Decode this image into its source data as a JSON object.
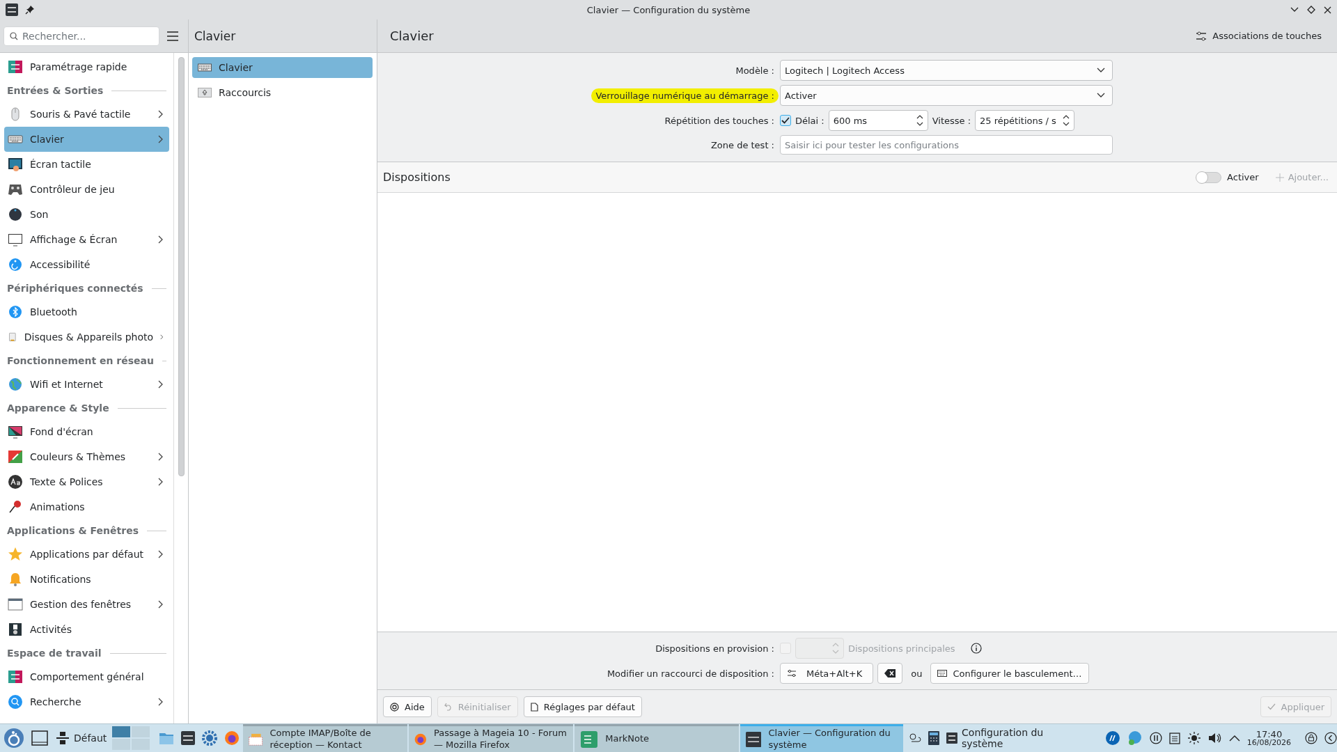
{
  "window": {
    "title": "Clavier — Configuration du système"
  },
  "sidebar": {
    "search": {
      "placeholder": "Rechercher..."
    },
    "entries": [
      {
        "kind": "item",
        "label": "Paramétrage rapide",
        "selected": false,
        "submenu": false
      },
      {
        "kind": "header",
        "label": "Entrées & Sorties"
      },
      {
        "kind": "item",
        "label": "Souris & Pavé tactile",
        "selected": false,
        "submenu": true
      },
      {
        "kind": "item",
        "label": "Clavier",
        "selected": true,
        "submenu": true
      },
      {
        "kind": "item",
        "label": "Écran tactile",
        "selected": false,
        "submenu": false
      },
      {
        "kind": "item",
        "label": "Contrôleur de jeu",
        "selected": false,
        "submenu": false
      },
      {
        "kind": "item",
        "label": "Son",
        "selected": false,
        "submenu": false
      },
      {
        "kind": "item",
        "label": "Affichage & Écran",
        "selected": false,
        "submenu": true
      },
      {
        "kind": "item",
        "label": "Accessibilité",
        "selected": false,
        "submenu": false
      },
      {
        "kind": "header",
        "label": "Périphériques connectés"
      },
      {
        "kind": "item",
        "label": "Bluetooth",
        "selected": false,
        "submenu": false
      },
      {
        "kind": "item",
        "label": "Disques & Appareils photo",
        "selected": false,
        "submenu": true
      },
      {
        "kind": "header",
        "label": "Fonctionnement en réseau"
      },
      {
        "kind": "item",
        "label": "Wifi et Internet",
        "selected": false,
        "submenu": true
      },
      {
        "kind": "header",
        "label": "Apparence & Style"
      },
      {
        "kind": "item",
        "label": "Fond d'écran",
        "selected": false,
        "submenu": false
      },
      {
        "kind": "item",
        "label": "Couleurs & Thèmes",
        "selected": false,
        "submenu": true
      },
      {
        "kind": "item",
        "label": "Texte & Polices",
        "selected": false,
        "submenu": true
      },
      {
        "kind": "item",
        "label": "Animations",
        "selected": false,
        "submenu": false
      },
      {
        "kind": "header",
        "label": "Applications & Fenêtres"
      },
      {
        "kind": "item",
        "label": "Applications par défaut",
        "selected": false,
        "submenu": true
      },
      {
        "kind": "item",
        "label": "Notifications",
        "selected": false,
        "submenu": false
      },
      {
        "kind": "item",
        "label": "Gestion des fenêtres",
        "selected": false,
        "submenu": true
      },
      {
        "kind": "item",
        "label": "Activités",
        "selected": false,
        "submenu": false
      },
      {
        "kind": "header",
        "label": "Espace de travail"
      },
      {
        "kind": "item",
        "label": "Comportement général",
        "selected": false,
        "submenu": false
      },
      {
        "kind": "item",
        "label": "Recherche",
        "selected": false,
        "submenu": true
      }
    ]
  },
  "subpages": {
    "title": "Clavier",
    "items": [
      {
        "label": "Clavier",
        "selected": true
      },
      {
        "label": "Raccourcis",
        "selected": false
      }
    ]
  },
  "page": {
    "title": "Clavier",
    "header_button": "Associations de touches",
    "model": {
      "label": "Modèle :",
      "value": "Logitech | Logitech Access"
    },
    "numlock": {
      "label": "Verrouillage numérique au démarrage :",
      "value": "Activer",
      "highlighted": true
    },
    "repeat": {
      "label": "Répétition des touches :",
      "checked": true,
      "delay_label": "Délai :",
      "delay": "600 ms",
      "rate_label": "Vitesse :",
      "rate": "25 répétitions / s"
    },
    "test": {
      "label": "Zone de test :",
      "placeholder": "Saisir ici pour tester les configurations"
    },
    "layouts": {
      "title": "Dispositions",
      "toggle": {
        "label": "Activer",
        "on": false
      },
      "add": {
        "label": "Ajouter...",
        "disabled": true
      }
    },
    "spare": {
      "label": "Dispositions en provision :",
      "checked": false,
      "disabled": true,
      "suffix": "Dispositions principales"
    },
    "shortcut": {
      "label": "Modifier un raccourci de disposition :",
      "key": "Méta+Alt+K",
      "or": "ou",
      "configure": "Configurer le basculement…"
    },
    "buttons": [
      {
        "label": "Aide",
        "disabled": false
      },
      {
        "label": "Réinitialiser",
        "disabled": true
      },
      {
        "label": "Réglages par défaut",
        "disabled": false
      }
    ],
    "apply": {
      "label": "Appliquer",
      "disabled": true
    }
  },
  "taskbar": {
    "pager_label": "Défaut",
    "desktops": [
      {
        "selected": true
      },
      {
        "selected": false
      },
      {
        "selected": false
      },
      {
        "selected": false
      }
    ],
    "tasks": [
      {
        "label": "Compte IMAP/Boîte de réception — Kontact",
        "selected": false
      },
      {
        "label": "Passage à Mageia 10 - Forum — Mozilla Firefox",
        "selected": false
      },
      {
        "label": "MarkNote",
        "selected": false
      },
      {
        "label": "Clavier  — Configuration du système",
        "selected": true
      }
    ],
    "tray_app": "Configuration du système",
    "time": "17:40",
    "date": "16/08/2026"
  }
}
